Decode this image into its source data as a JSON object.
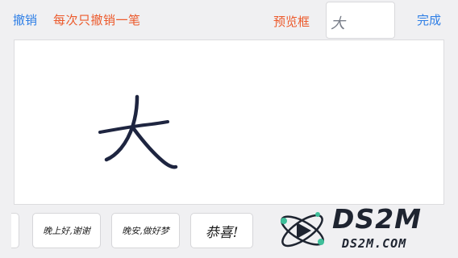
{
  "toolbar": {
    "undo_label": "撤销",
    "undo_note": "每次只撤销一笔",
    "preview_note": "预览框",
    "preview_char": "大",
    "done_label": "完成"
  },
  "samples": [
    {
      "text": "晚上好,谢谢"
    },
    {
      "text": "晚安,做好梦"
    },
    {
      "text": "恭喜!"
    }
  ],
  "watermark": {
    "title": "DS2M",
    "subtitle": "DS2M.COM"
  },
  "colors": {
    "accent_blue": "#2f7fe6",
    "annotation_orange": "#ec5a2c",
    "ink": "#1e2540"
  }
}
